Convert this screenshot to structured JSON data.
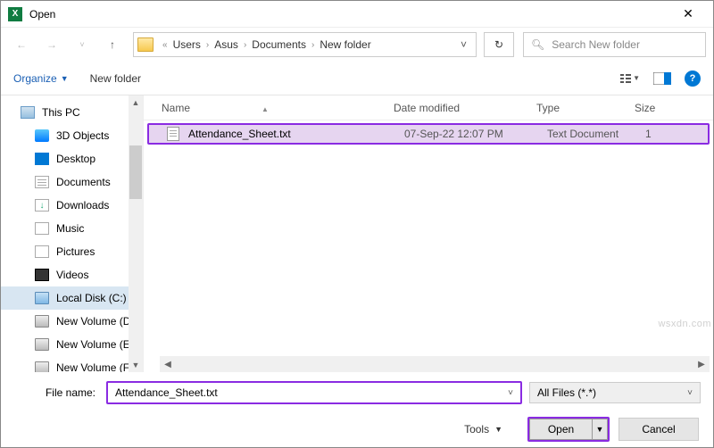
{
  "window": {
    "title": "Open"
  },
  "breadcrumbs": {
    "sep_first": "«",
    "items": [
      "Users",
      "Asus",
      "Documents",
      "New folder"
    ]
  },
  "search": {
    "placeholder": "Search New folder"
  },
  "toolbar": {
    "organize": "Organize",
    "newfolder": "New folder"
  },
  "sidebar": {
    "items": [
      {
        "label": "This PC"
      },
      {
        "label": "3D Objects"
      },
      {
        "label": "Desktop"
      },
      {
        "label": "Documents"
      },
      {
        "label": "Downloads"
      },
      {
        "label": "Music"
      },
      {
        "label": "Pictures"
      },
      {
        "label": "Videos"
      },
      {
        "label": "Local Disk (C:)"
      },
      {
        "label": "New Volume (D:)"
      },
      {
        "label": "New Volume (E:)"
      },
      {
        "label": "New Volume (F:)"
      }
    ]
  },
  "columns": {
    "name": "Name",
    "date": "Date modified",
    "type": "Type",
    "size": "Size"
  },
  "files": [
    {
      "name": "Attendance_Sheet.txt",
      "date": "07-Sep-22 12:07 PM",
      "type": "Text Document",
      "size": "1"
    }
  ],
  "filename": {
    "label": "File name:",
    "value": "Attendance_Sheet.txt"
  },
  "filter": {
    "label": "All Files (*.*)"
  },
  "buttons": {
    "tools": "Tools",
    "open": "Open",
    "cancel": "Cancel"
  },
  "watermark": "wsxdn.com"
}
